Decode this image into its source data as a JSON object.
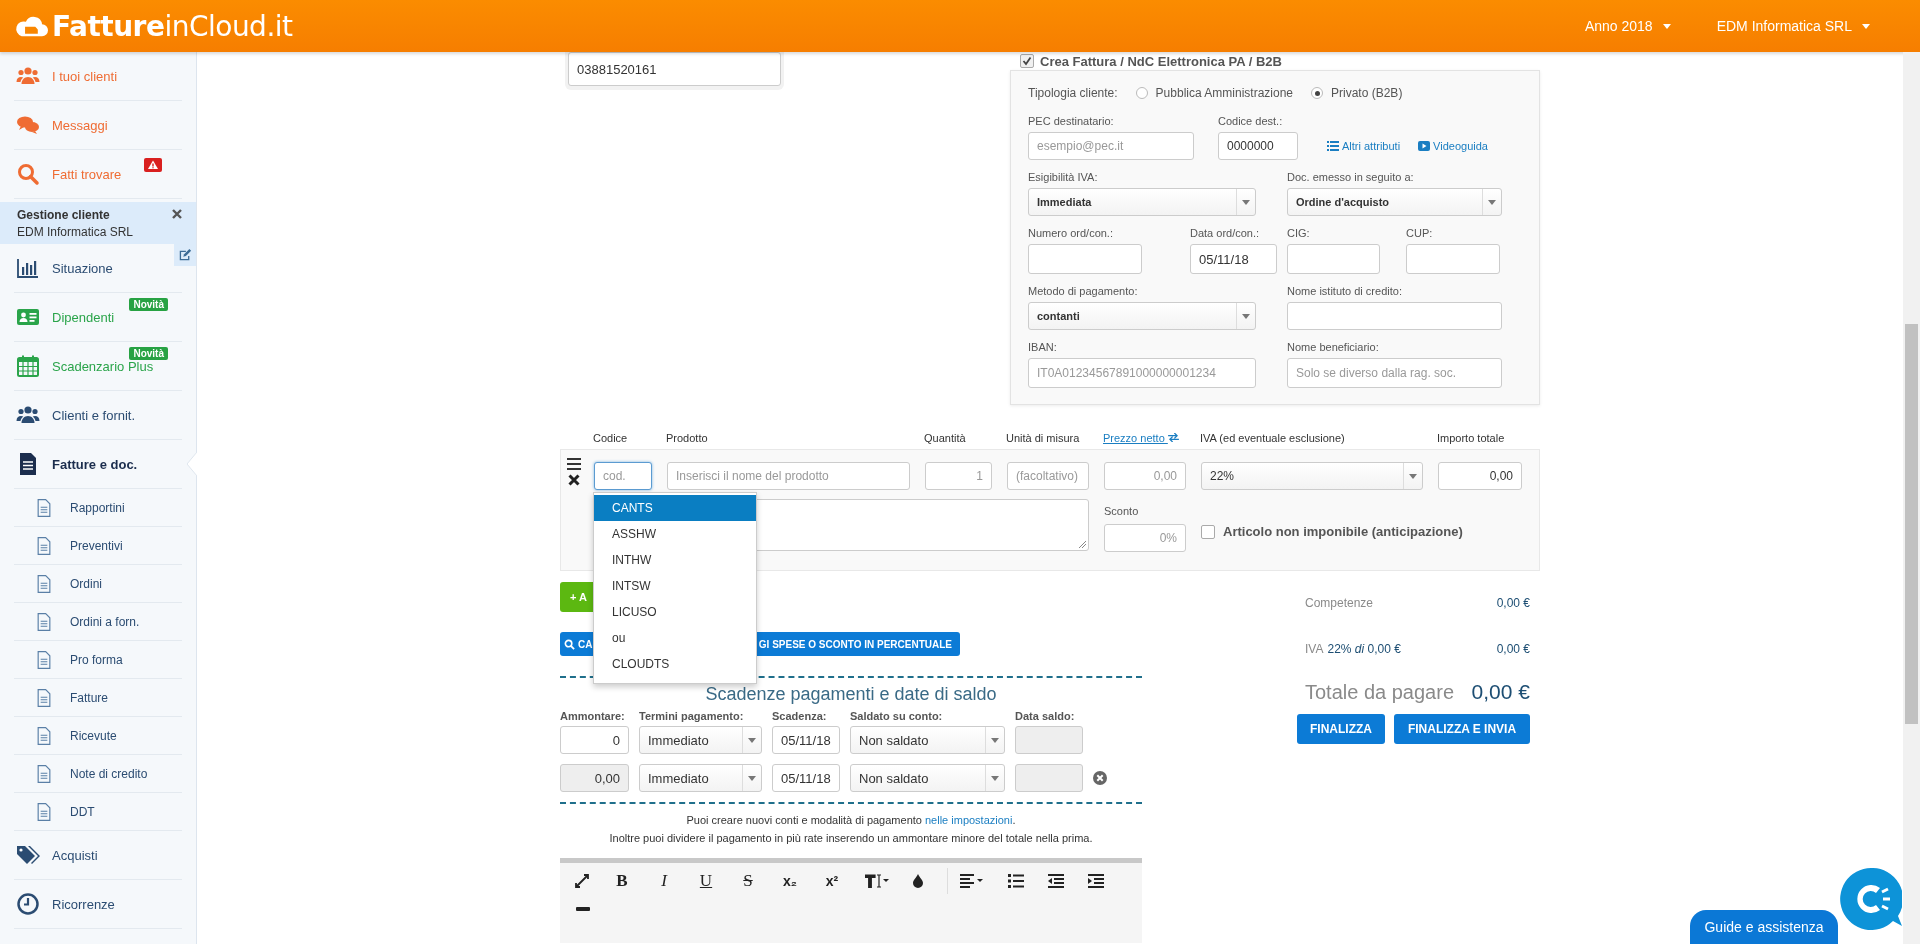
{
  "header": {
    "logo": "**Fatture**inCloud.it",
    "menus": [
      {
        "label": "Anno 2018"
      },
      {
        "label": "EDM Informatica SRL"
      }
    ]
  },
  "sidebar": {
    "top_items": [
      {
        "label": "I tuoi clienti",
        "color": "#ef6c33",
        "selected": false,
        "alert": false
      },
      {
        "label": "Messaggi",
        "color": "#ef6c33",
        "selected": false,
        "alert": false
      },
      {
        "label": "Fatti trovare",
        "color": "#ef6c33",
        "selected": false,
        "alert": true
      }
    ],
    "client_panel": {
      "title": "Gestione cliente",
      "client": "EDM Informatica SRL"
    },
    "items": [
      {
        "label": "Situazione",
        "color": "#2b4c72",
        "selected": false
      },
      {
        "label": "Dipendenti",
        "color": "#2aa44a",
        "selected": false,
        "badge": "Novità"
      },
      {
        "label": "Scadenzario Plus",
        "color": "#2aa44a",
        "selected": false,
        "badge": "Novità"
      },
      {
        "label": "Clienti e fornit.",
        "color": "#2b4c72",
        "selected": false
      },
      {
        "label": "Fatture e doc.",
        "color": "#1b2d4d",
        "selected": true,
        "children": [
          {
            "label": "Rapportini",
            "selected": false
          },
          {
            "label": "Preventivi",
            "selected": false
          },
          {
            "label": "Ordini",
            "selected": false
          },
          {
            "label": "Ordini a forn.",
            "selected": false
          },
          {
            "label": "Pro forma",
            "selected": false
          },
          {
            "label": "Fatture",
            "selected": false
          },
          {
            "label": "Ricevute",
            "selected": false
          },
          {
            "label": "Note di credito",
            "selected": false
          },
          {
            "label": "DDT",
            "selected": false
          }
        ]
      },
      {
        "label": "Acquisti",
        "color": "#2b4c72",
        "selected": false
      },
      {
        "label": "Ricorrenze",
        "color": "#2b4c72",
        "selected": false
      }
    ]
  },
  "vat_card": {
    "value": "03881520161"
  },
  "einvoice": {
    "checkbox": {
      "label": "Crea Fattura / NdC Elettronica PA / B2B",
      "checked": true
    },
    "client_type": {
      "label": "Tipologia cliente:",
      "options": [
        {
          "label": "Pubblica Amministrazione",
          "selected": false
        },
        {
          "label": "Privato (B2B)",
          "selected": true
        }
      ]
    },
    "pec": {
      "label": "PEC destinatario:",
      "placeholder": "esempio@pec.it"
    },
    "codice_dest": {
      "label": "Codice dest.:",
      "value": "0000000"
    },
    "links": [
      {
        "label": "Altri attributi"
      },
      {
        "label": "Videoguida"
      }
    ],
    "esigibilita": {
      "label": "Esigibilità IVA:",
      "value": "Immediata"
    },
    "doc_emesso": {
      "label": "Doc. emesso in seguito a:",
      "value": "Ordine d'acquisto"
    },
    "numero_ord": {
      "label": "Numero ord/con.:"
    },
    "data_ord": {
      "label": "Data ord/con.:",
      "value": "05/11/18"
    },
    "cig": {
      "label": "CIG:"
    },
    "cup": {
      "label": "CUP:"
    },
    "metodo": {
      "label": "Metodo di pagamento:",
      "value": "contanti"
    },
    "istituto": {
      "label": "Nome istituto di credito:"
    },
    "iban": {
      "label": "IBAN:",
      "placeholder": "IT0A01234567891000000001234"
    },
    "beneficiario": {
      "label": "Nome beneficiario:",
      "placeholder": "Solo se diverso dalla rag. soc."
    }
  },
  "products": {
    "columns": [
      {
        "label": "Codice",
        "kind": "text"
      },
      {
        "label": "Prodotto",
        "kind": "text"
      },
      {
        "label": "Quantità",
        "kind": "text"
      },
      {
        "label": "Unità di misura",
        "kind": "text"
      },
      {
        "label": "Prezzo netto",
        "kind": "link"
      },
      {
        "label": "IVA (ed eventuale esclusione)",
        "kind": "text"
      },
      {
        "label": "Importo totale",
        "kind": "text"
      }
    ],
    "row": {
      "code_placeholder": "cod.",
      "product_placeholder": "Inserisci il nome del prodotto",
      "qty_placeholder": "1",
      "unit_placeholder": "(facoltativo)",
      "price_placeholder": "0,00",
      "vat": "22%",
      "total": "0,00",
      "discount_label": "Sconto",
      "discount_placeholder": "0%",
      "exempt": {
        "label": "Articolo non imponibile (anticipazione)",
        "checked": false
      }
    },
    "suggestions": [
      {
        "label": "CANTS",
        "selected": true
      },
      {
        "label": "ASSHW",
        "selected": false
      },
      {
        "label": "INTHW",
        "selected": false
      },
      {
        "label": "INTSW",
        "selected": false
      },
      {
        "label": "LICUSO",
        "selected": false
      },
      {
        "label": "ou",
        "selected": false
      },
      {
        "label": "CLOUDTS",
        "selected": false
      }
    ]
  },
  "add_button": {
    "label": "+ A"
  },
  "expenses_button": {
    "label_left": "CA",
    "label_right": "GI SPESE O SCONTO IN PERCENTUALE"
  },
  "payments": {
    "title": "Scadenze pagamenti e date di saldo",
    "columns": [
      "Ammontare:",
      "Termini pagamento:",
      "Scadenza:",
      "Saldato su conto:",
      "Data saldo:"
    ],
    "rows": [
      {
        "amount": "0",
        "amount_disabled": false,
        "term": "Immediato",
        "due": "05/11/18",
        "account": "Non saldato",
        "removable": false
      },
      {
        "amount": "0,00",
        "amount_disabled": true,
        "term": "Immediato",
        "due": "05/11/18",
        "account": "Non saldato",
        "removable": true
      }
    ],
    "note": {
      "before": "Puoi creare nuovi conti e modalità di pagamento ",
      "link": "nelle impostazioni",
      "after": "."
    },
    "note2": "Inoltre puoi dividere il pagamento in più rate inserendo un ammontare minore del totale nella prima."
  },
  "editor": {
    "glyphs": [
      "B",
      "I",
      "U",
      "S",
      "x₂",
      "x²"
    ]
  },
  "totals": {
    "competenze": {
      "label": "Competenze",
      "value": "0,00 €"
    },
    "iva": {
      "label": "IVA",
      "detail": "22% *di* 0,00 €",
      "value": "0,00 €"
    },
    "totale": {
      "label": "Totale da pagare",
      "value": "0,00 €"
    },
    "buttons": [
      {
        "label": "FINALIZZA"
      },
      {
        "label": "FINALIZZA E INVIA"
      }
    ]
  },
  "chat": {
    "label": "Guide e assistenza"
  }
}
